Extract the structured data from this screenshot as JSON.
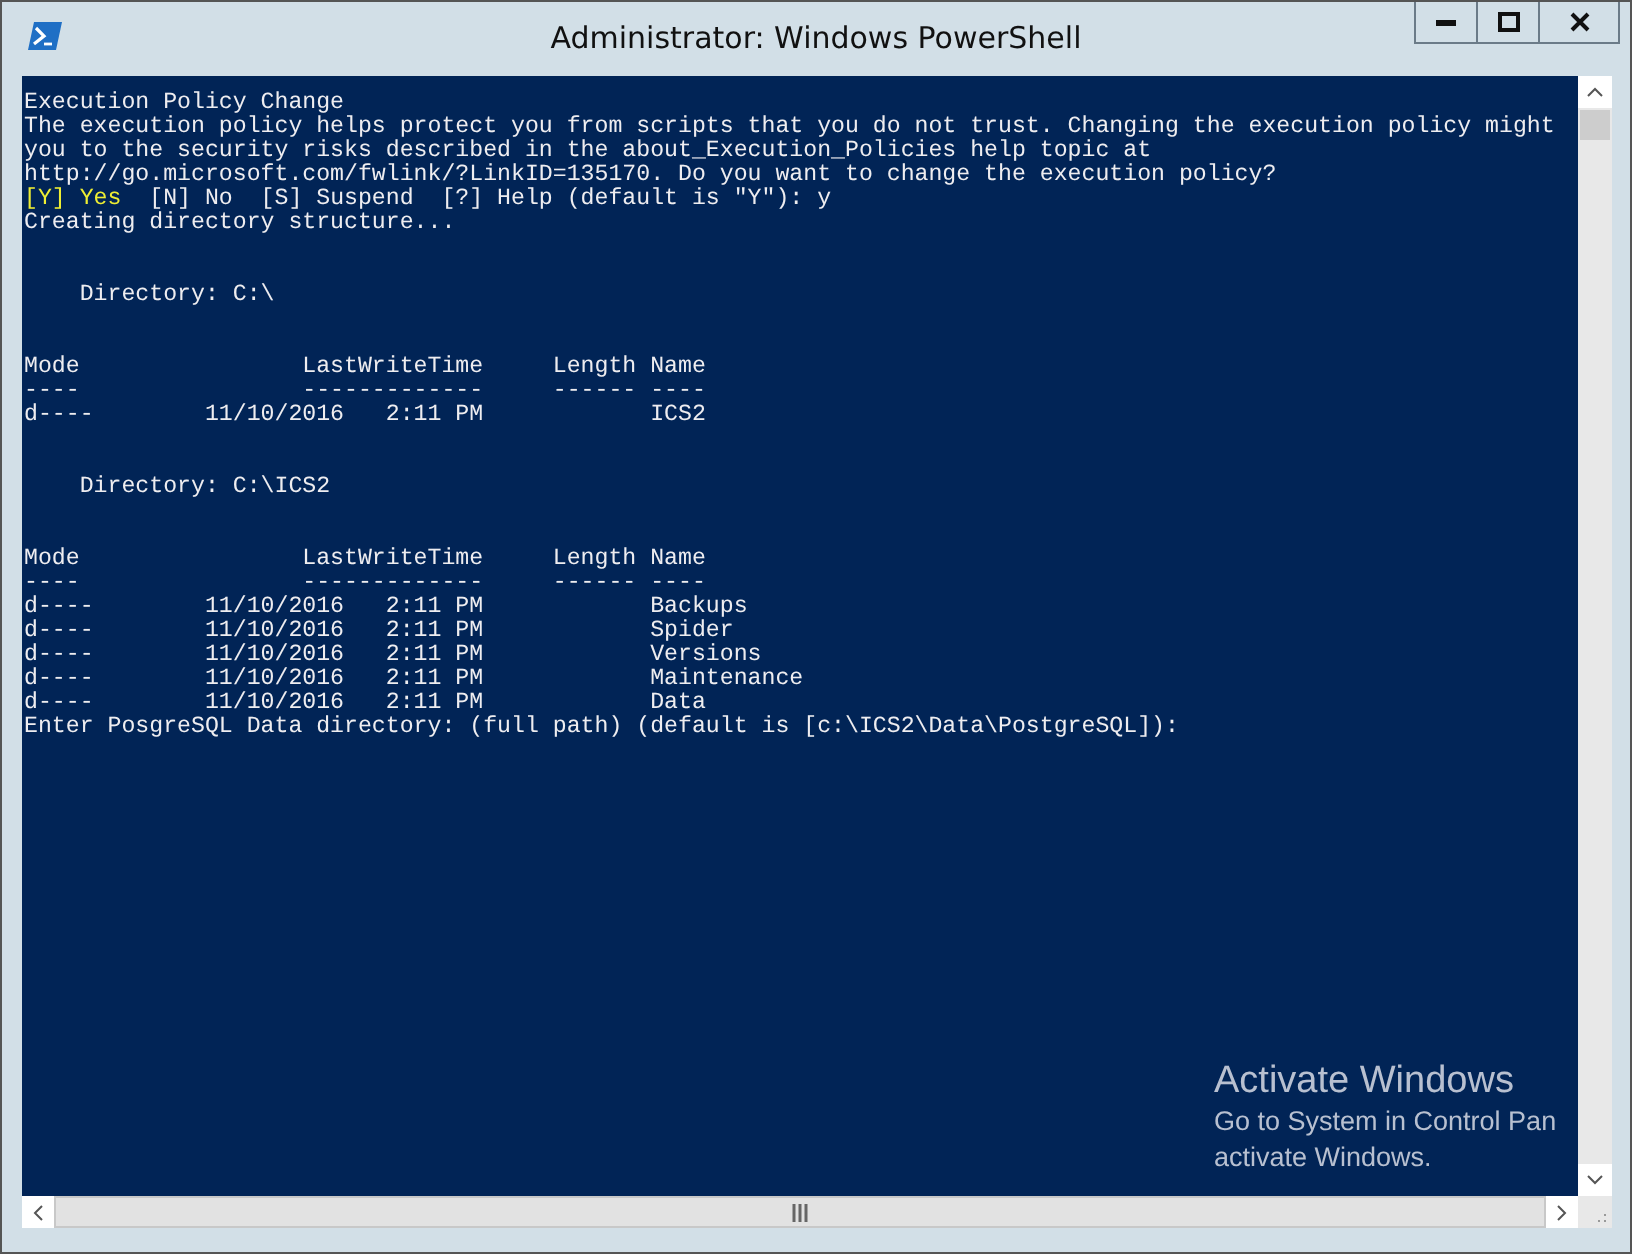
{
  "window": {
    "title": "Administrator: Windows PowerShell"
  },
  "console": {
    "lines": [
      {
        "kind": "text",
        "text": "Execution Policy Change"
      },
      {
        "kind": "text",
        "text": "The execution policy helps protect you from scripts that you do not trust. Changing the execution policy might"
      },
      {
        "kind": "text",
        "text": "you to the security risks described in the about_Execution_Policies help topic at"
      },
      {
        "kind": "text",
        "text": "http://go.microsoft.com/fwlink/?LinkID=135170. Do you want to change the execution policy?"
      },
      {
        "kind": "choice",
        "highlight": "[Y] Yes",
        "text": "  [N] No  [S] Suspend  [?] Help (default is \"Y\"): y"
      },
      {
        "kind": "text",
        "text": "Creating directory structure..."
      },
      {
        "kind": "blank"
      },
      {
        "kind": "blank"
      },
      {
        "kind": "text",
        "text": "    Directory: C:\\"
      },
      {
        "kind": "blank"
      },
      {
        "kind": "blank"
      },
      {
        "kind": "text",
        "text": "Mode                LastWriteTime     Length Name"
      },
      {
        "kind": "text",
        "text": "----                -------------     ------ ----"
      },
      {
        "kind": "text",
        "text": "d----        11/10/2016   2:11 PM            ICS2"
      },
      {
        "kind": "blank"
      },
      {
        "kind": "blank"
      },
      {
        "kind": "text",
        "text": "    Directory: C:\\ICS2"
      },
      {
        "kind": "blank"
      },
      {
        "kind": "blank"
      },
      {
        "kind": "text",
        "text": "Mode                LastWriteTime     Length Name"
      },
      {
        "kind": "text",
        "text": "----                -------------     ------ ----"
      },
      {
        "kind": "text",
        "text": "d----        11/10/2016   2:11 PM            Backups"
      },
      {
        "kind": "text",
        "text": "d----        11/10/2016   2:11 PM            Spider"
      },
      {
        "kind": "text",
        "text": "d----        11/10/2016   2:11 PM            Versions"
      },
      {
        "kind": "text",
        "text": "d----        11/10/2016   2:11 PM            Maintenance"
      },
      {
        "kind": "text",
        "text": "d----        11/10/2016   2:11 PM            Data"
      },
      {
        "kind": "text",
        "text": "Enter PosgreSQL Data directory: (full path) (default is [c:\\ICS2\\Data\\PostgreSQL]):"
      }
    ]
  },
  "activation_notice": {
    "title": "Activate Windows",
    "lines": [
      "Go to System in Control Pan",
      "activate Windows."
    ]
  }
}
